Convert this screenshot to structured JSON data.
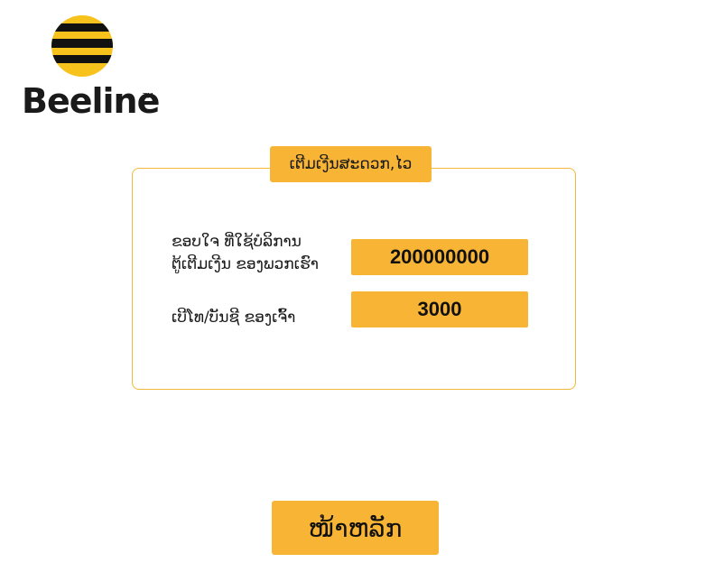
{
  "brand": {
    "name": "Beeline",
    "trademark": "TM",
    "colors": {
      "yellow": "#f8b535",
      "black": "#1a1a1a"
    }
  },
  "panel": {
    "title": "ເຕີມເງີນສະດວກ,ໄວ"
  },
  "rows": [
    {
      "label_line1": "ຂອບໃຈ ທີ່ໃຊ້ບໍລິການ",
      "label_line2": "ຕູ້ເຕີມເງີນ ຂອງພວກເຮົາ",
      "value": "200000000"
    },
    {
      "label_line1": "ເບີໂທ/ບັນຊີ ຂອງເຈົ້າ",
      "value": "3000"
    }
  ],
  "home_button": {
    "label": "ໜ້າຫລັກ"
  }
}
